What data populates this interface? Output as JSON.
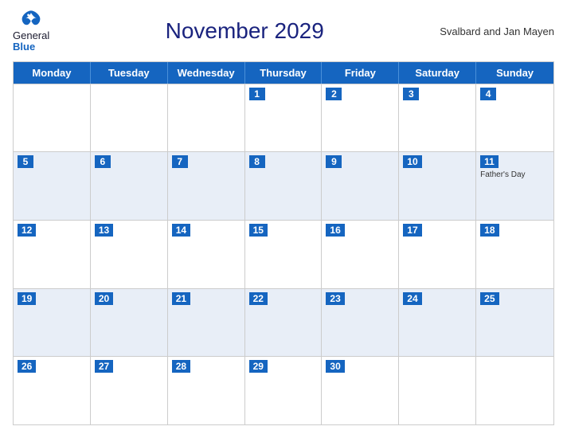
{
  "logo": {
    "general": "General",
    "blue": "Blue",
    "bird_color": "#1565c0"
  },
  "title": "November 2029",
  "region": "Svalbard and Jan Mayen",
  "day_names": [
    "Monday",
    "Tuesday",
    "Wednesday",
    "Thursday",
    "Friday",
    "Saturday",
    "Sunday"
  ],
  "weeks": [
    {
      "shaded": false,
      "cells": [
        {
          "date": "",
          "event": ""
        },
        {
          "date": "",
          "event": ""
        },
        {
          "date": "",
          "event": ""
        },
        {
          "date": "1",
          "event": ""
        },
        {
          "date": "2",
          "event": ""
        },
        {
          "date": "3",
          "event": ""
        },
        {
          "date": "4",
          "event": ""
        }
      ]
    },
    {
      "shaded": true,
      "cells": [
        {
          "date": "5",
          "event": ""
        },
        {
          "date": "6",
          "event": ""
        },
        {
          "date": "7",
          "event": ""
        },
        {
          "date": "8",
          "event": ""
        },
        {
          "date": "9",
          "event": ""
        },
        {
          "date": "10",
          "event": ""
        },
        {
          "date": "11",
          "event": "Father's Day"
        }
      ]
    },
    {
      "shaded": false,
      "cells": [
        {
          "date": "12",
          "event": ""
        },
        {
          "date": "13",
          "event": ""
        },
        {
          "date": "14",
          "event": ""
        },
        {
          "date": "15",
          "event": ""
        },
        {
          "date": "16",
          "event": ""
        },
        {
          "date": "17",
          "event": ""
        },
        {
          "date": "18",
          "event": ""
        }
      ]
    },
    {
      "shaded": true,
      "cells": [
        {
          "date": "19",
          "event": ""
        },
        {
          "date": "20",
          "event": ""
        },
        {
          "date": "21",
          "event": ""
        },
        {
          "date": "22",
          "event": ""
        },
        {
          "date": "23",
          "event": ""
        },
        {
          "date": "24",
          "event": ""
        },
        {
          "date": "25",
          "event": ""
        }
      ]
    },
    {
      "shaded": false,
      "cells": [
        {
          "date": "26",
          "event": ""
        },
        {
          "date": "27",
          "event": ""
        },
        {
          "date": "28",
          "event": ""
        },
        {
          "date": "29",
          "event": ""
        },
        {
          "date": "30",
          "event": ""
        },
        {
          "date": "",
          "event": ""
        },
        {
          "date": "",
          "event": ""
        }
      ]
    }
  ]
}
